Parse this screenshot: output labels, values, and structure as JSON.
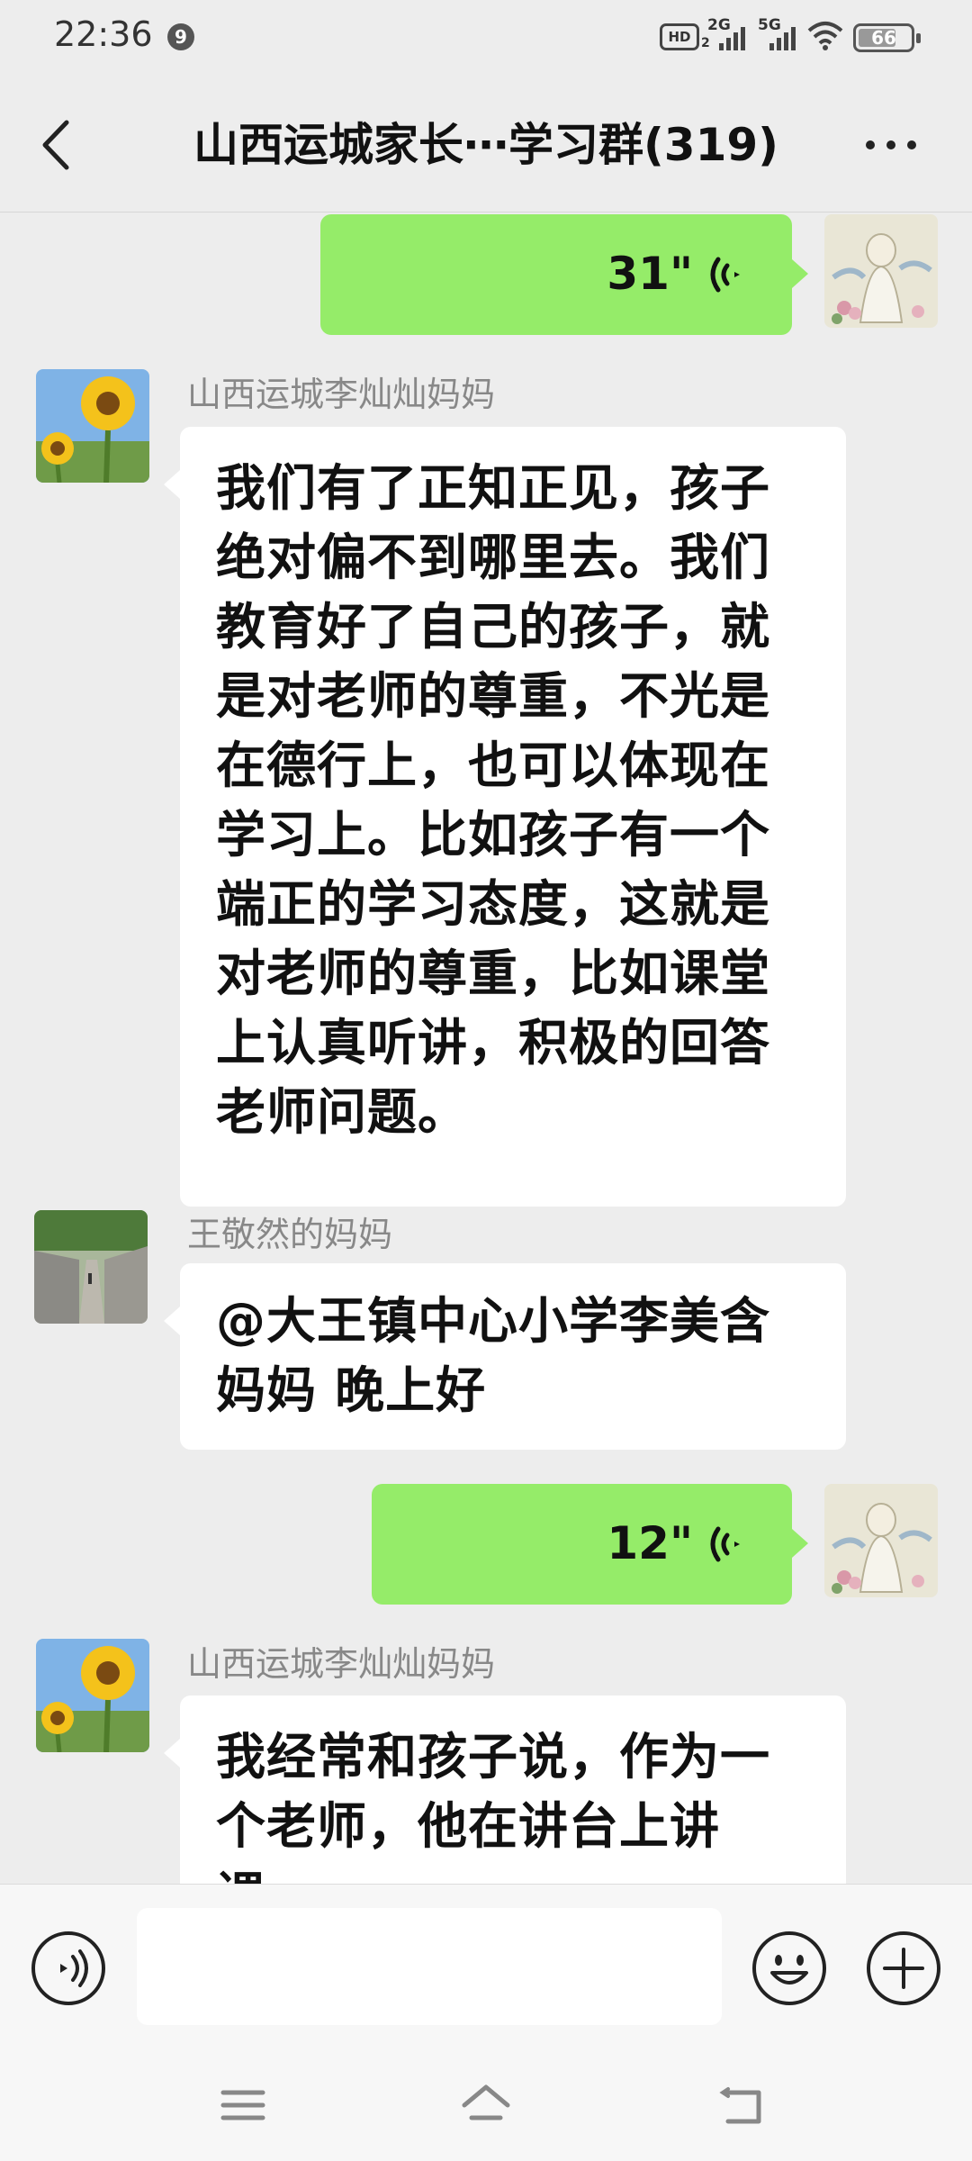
{
  "status_bar": {
    "time": "22:36",
    "notification_count": "9",
    "hd_label": "HD",
    "hd_sub": "2",
    "net1": "2G",
    "net2": "5G",
    "battery": "66"
  },
  "header": {
    "title": "山西运城家长⋯学习群(319)"
  },
  "messages": [
    {
      "type": "voice",
      "direction": "out",
      "duration": "31\""
    },
    {
      "type": "text",
      "direction": "in",
      "sender": "山西运城李灿灿妈妈",
      "text": "我们有了正知正见，孩子\n绝对偏不到哪里去。我们\n教育好了自己的孩子，就\n是对老师的尊重，不光是\n在德行上，也可以体现在\n学习上。比如孩子有一个\n端正的学习态度，这就是\n对老师的尊重，比如课堂\n上认真听讲，积极的回答\n老师问题。"
    },
    {
      "type": "text",
      "direction": "in",
      "sender": "王敬然的妈妈",
      "text": "@大王镇中心小学李美含\n妈妈  晚上好"
    },
    {
      "type": "voice",
      "direction": "out",
      "duration": "12\""
    },
    {
      "type": "text",
      "direction": "in",
      "sender": "山西运城李灿灿妈妈",
      "text": "我经常和孩子说，作为一\n个老师，他在讲台上讲课，\n他的眼睛就会去捕捉，捕"
    }
  ],
  "input": {
    "value": ""
  },
  "colors": {
    "background": "#ededed",
    "voice_bubble": "#95ec69",
    "incoming_bubble": "#ffffff"
  },
  "icons": [
    "back-icon",
    "more-icon",
    "voice-wave-icon",
    "voice-toggle-icon",
    "emoji-icon",
    "plus-icon",
    "menu-icon",
    "home-icon",
    "back-nav-icon"
  ]
}
